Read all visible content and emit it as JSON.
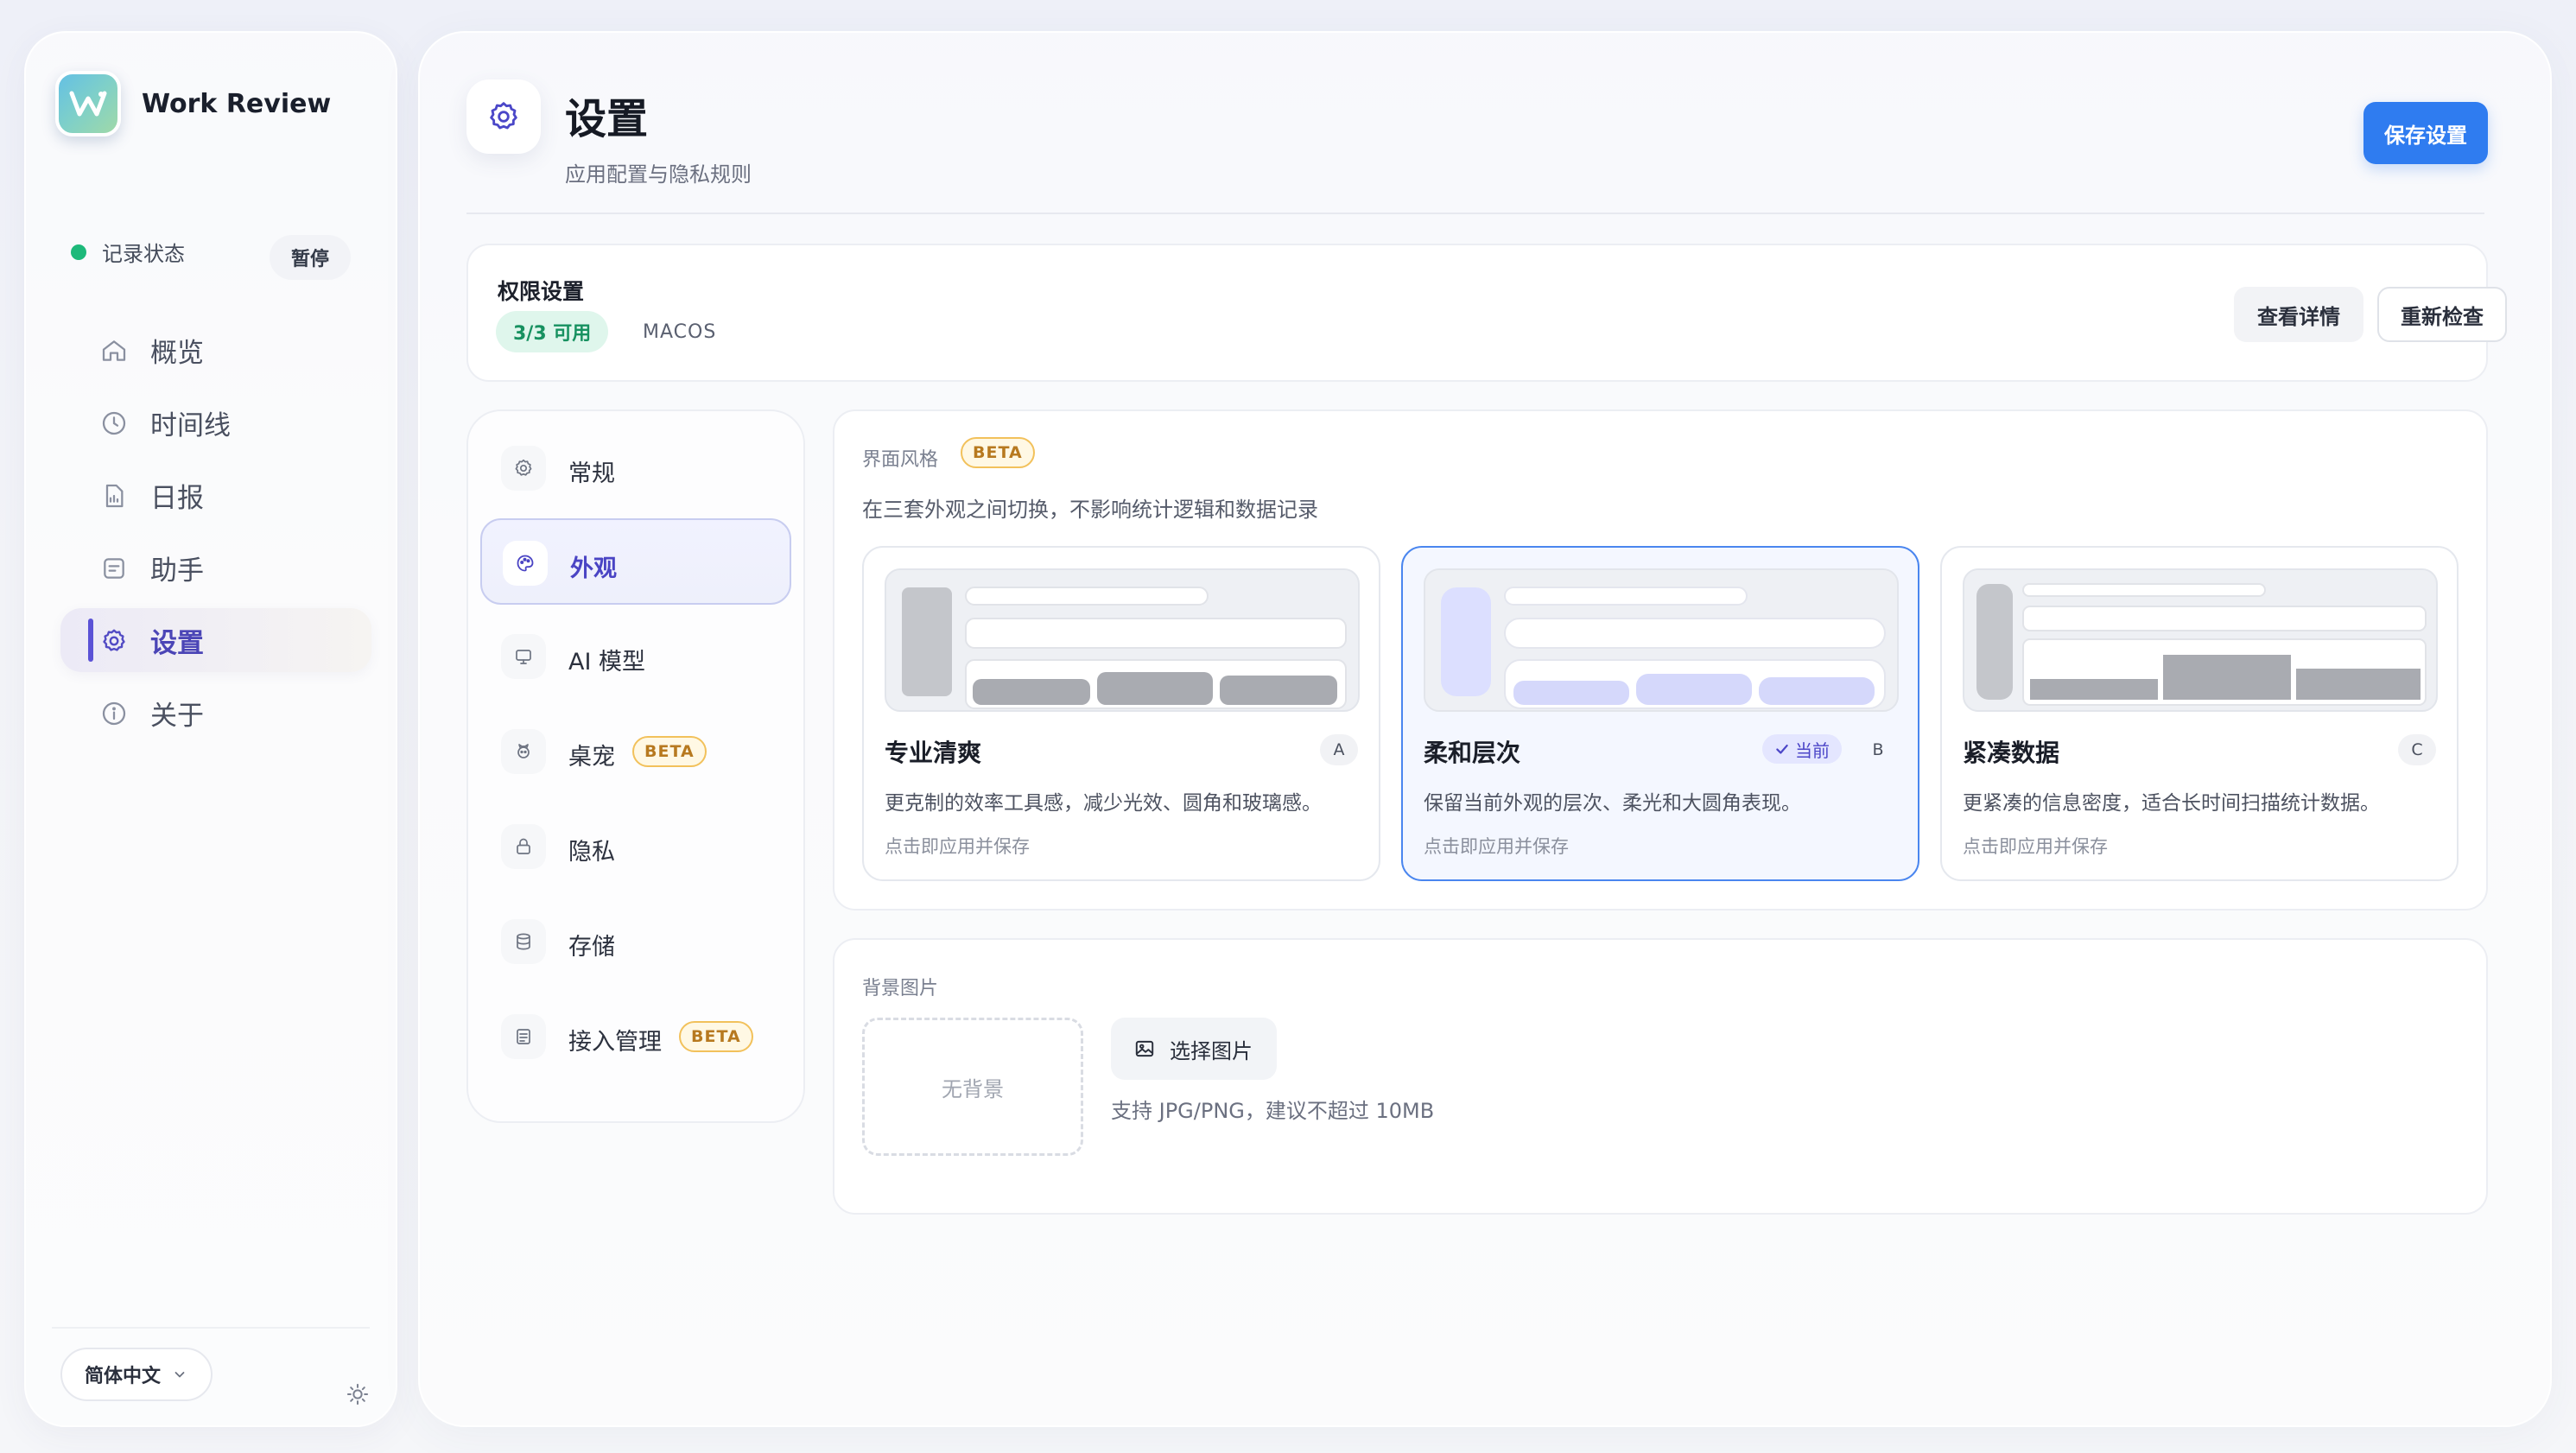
{
  "brand": {
    "name": "Work Review"
  },
  "record": {
    "label": "记录状态",
    "pause_label": "暂停"
  },
  "nav": {
    "items": [
      {
        "label": "概览",
        "icon": "home-icon"
      },
      {
        "label": "时间线",
        "icon": "clock-icon"
      },
      {
        "label": "日报",
        "icon": "report-icon"
      },
      {
        "label": "助手",
        "icon": "assistant-icon"
      },
      {
        "label": "设置",
        "icon": "gear-icon",
        "active": true
      },
      {
        "label": "关于",
        "icon": "info-icon"
      }
    ]
  },
  "language": {
    "selected": "简体中文"
  },
  "header": {
    "title": "设置",
    "subtitle": "应用配置与隐私规则",
    "save_label": "保存设置"
  },
  "permission": {
    "title": "权限设置",
    "badge": "3/3 可用",
    "os": "MACOS",
    "detail_label": "查看详情",
    "recheck_label": "重新检查"
  },
  "settings_nav": {
    "items": [
      {
        "label": "常规",
        "icon": "gear-icon"
      },
      {
        "label": "外观",
        "icon": "palette-icon",
        "active": true
      },
      {
        "label": "AI 模型",
        "icon": "monitor-icon"
      },
      {
        "label": "桌宠",
        "icon": "pet-icon",
        "beta": "BETA"
      },
      {
        "label": "隐私",
        "icon": "lock-icon"
      },
      {
        "label": "存储",
        "icon": "database-icon"
      },
      {
        "label": "接入管理",
        "icon": "plugin-icon",
        "beta": "BETA"
      }
    ]
  },
  "style": {
    "label": "界面风格",
    "beta": "BETA",
    "desc": "在三套外观之间切换，不影响统计逻辑和数据记录",
    "options": [
      {
        "name": "专业清爽",
        "letter": "A",
        "desc": "更克制的效率工具感，减少光效、圆角和玻璃感。",
        "hint": "点击即应用并保存"
      },
      {
        "name": "柔和层次",
        "letter": "B",
        "current": "当前",
        "desc": "保留当前外观的层次、柔光和大圆角表现。",
        "hint": "点击即应用并保存"
      },
      {
        "name": "紧凑数据",
        "letter": "C",
        "desc": "更紧凑的信息密度，适合长时间扫描统计数据。",
        "hint": "点击即应用并保存"
      }
    ]
  },
  "background": {
    "label": "背景图片",
    "none_label": "无背景",
    "pick_label": "选择图片",
    "hint": "支持 JPG/PNG，建议不超过 10MB"
  },
  "colors": {
    "accent": "#2f7cf0",
    "active_nav": "#5b52d6",
    "status_ok": "#1db97a",
    "beta": "#b7791f"
  }
}
